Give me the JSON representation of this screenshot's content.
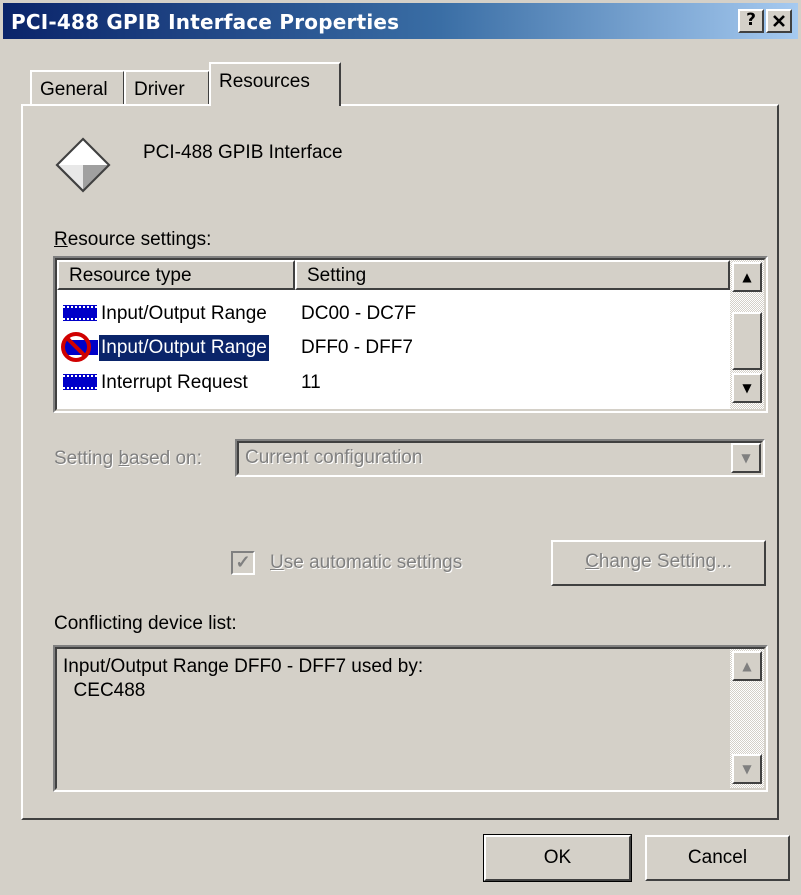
{
  "window": {
    "title": "PCI-488 GPIB Interface Properties",
    "help_label": "?",
    "close_label": "✕"
  },
  "tabs": [
    {
      "label": "General"
    },
    {
      "label": "Driver"
    },
    {
      "label": "Resources"
    }
  ],
  "device": {
    "name": "PCI-488 GPIB Interface",
    "icon": "device-diamond-icon"
  },
  "resource_settings": {
    "label_underlined": "R",
    "label_rest": "esource settings:",
    "columns": [
      "Resource type",
      "Setting"
    ],
    "rows": [
      {
        "type": "Input/Output Range",
        "setting": "DC00 - DC7F",
        "icon": "chip-icon",
        "conflict": false,
        "selected": false
      },
      {
        "type": "Input/Output Range",
        "setting": "DFF0 - DFF7",
        "icon": "conflict-icon",
        "conflict": true,
        "selected": true
      },
      {
        "type": "Interrupt Request",
        "setting": "11",
        "icon": "chip-icon",
        "conflict": false,
        "selected": false
      }
    ]
  },
  "setting_based_on": {
    "label_before": "Setting ",
    "label_underlined": "b",
    "label_after": "ased on:",
    "value": "Current configuration"
  },
  "automatic": {
    "checked": true,
    "label_underlined": "U",
    "label_rest": "se automatic settings"
  },
  "change_setting": {
    "label_underlined": "C",
    "label_rest": "hange Setting..."
  },
  "conflicting": {
    "label": "Conflicting device list:",
    "text": "Input/Output Range DFF0 - DFF7 used by:\n  CEC488"
  },
  "buttons": {
    "ok": "OK",
    "cancel": "Cancel"
  },
  "colors": {
    "face": "#d4d0c8",
    "selection": "#0a246a",
    "title_start": "#0a246a",
    "title_end": "#a6caf0",
    "chip_blue": "#0000c8",
    "conflict_red": "#d00000"
  }
}
